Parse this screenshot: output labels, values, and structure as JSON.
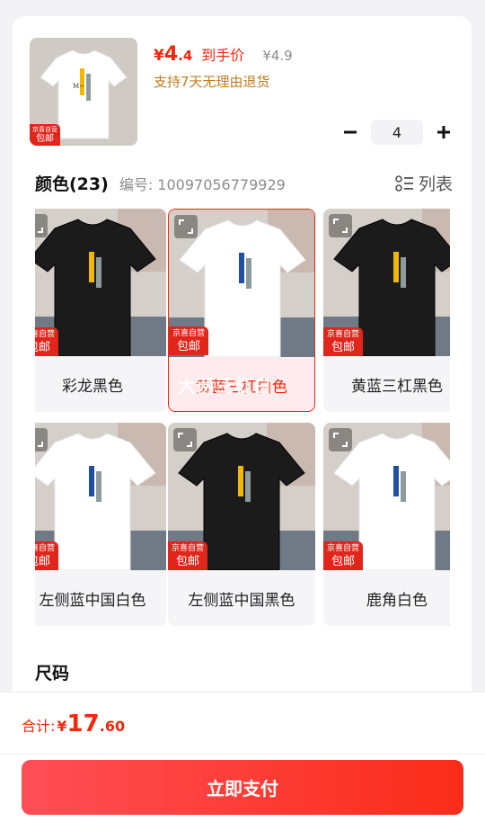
{
  "product": {
    "price_currency": "¥",
    "price_main": "4",
    "price_tail": ".4",
    "price_label": "到手价",
    "original_price": "¥4.9",
    "return_policy": "支持7天无理由退货",
    "quantity": "4",
    "badge_line1": "京喜自营",
    "badge_line2": "包邮"
  },
  "spec": {
    "title": "颜色(23)",
    "code": "编号: 10097056779929",
    "list_label": "列表"
  },
  "colors": [
    {
      "label": "彩龙黑色",
      "shirt": "#1b1b1b",
      "selected": false
    },
    {
      "label": "黄蓝三杠白色",
      "shirt": "#ffffff",
      "selected": true,
      "ghost": "大两三杠白"
    },
    {
      "label": "黄蓝三杠黑色",
      "shirt": "#1b1b1b",
      "selected": false
    },
    {
      "label": "左侧蓝中国白色",
      "shirt": "#ffffff",
      "selected": false
    },
    {
      "label": "左侧蓝中国黑色",
      "shirt": "#1b1b1b",
      "selected": false
    },
    {
      "label": "鹿角白色",
      "shirt": "#ffffff",
      "selected": false
    }
  ],
  "size": {
    "title": "尺码"
  },
  "footer": {
    "total_label": "合计:",
    "total_currency": "¥",
    "total_main": "17",
    "total_tail": ".60",
    "pay_label": "立即支付"
  },
  "theme": {
    "accent": "#f2270c",
    "badge": "#e1251b"
  }
}
